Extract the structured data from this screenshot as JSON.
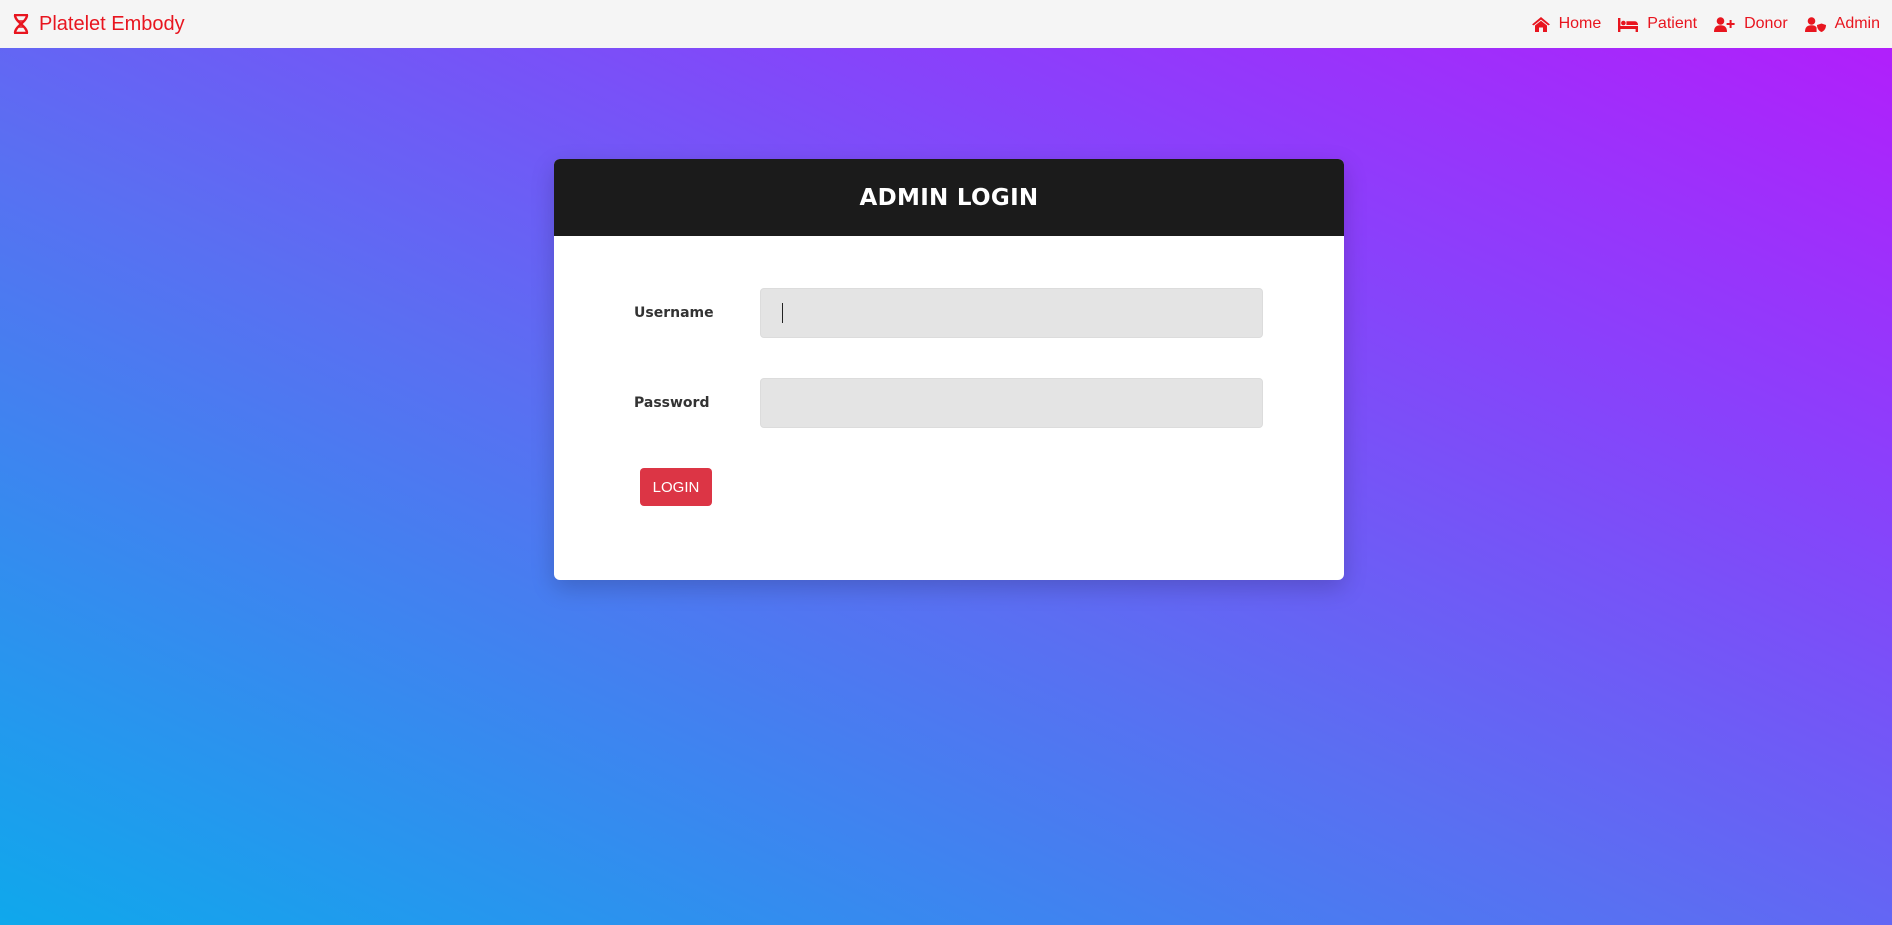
{
  "navbar": {
    "brand": "Platelet Embody",
    "links": [
      {
        "label": "Home",
        "icon": "home-icon"
      },
      {
        "label": "Patient",
        "icon": "bed-icon"
      },
      {
        "label": "Donor",
        "icon": "user-plus-icon"
      },
      {
        "label": "Admin",
        "icon": "user-shield-icon"
      }
    ]
  },
  "colors": {
    "brand": "#e8151f",
    "navbar_bg": "#f5f5f5",
    "gradient": [
      "#0fa8ec",
      "#5b6ef2",
      "#8a40fb",
      "#b11ffb"
    ],
    "card_header_bg": "#1b1b1b",
    "button": "#dc3545",
    "input_bg": "#e4e4e4"
  },
  "login": {
    "title": "ADMIN LOGIN",
    "username_label": "Username",
    "username_value": "",
    "password_label": "Password",
    "password_value": "",
    "button_label": "LOGIN"
  }
}
